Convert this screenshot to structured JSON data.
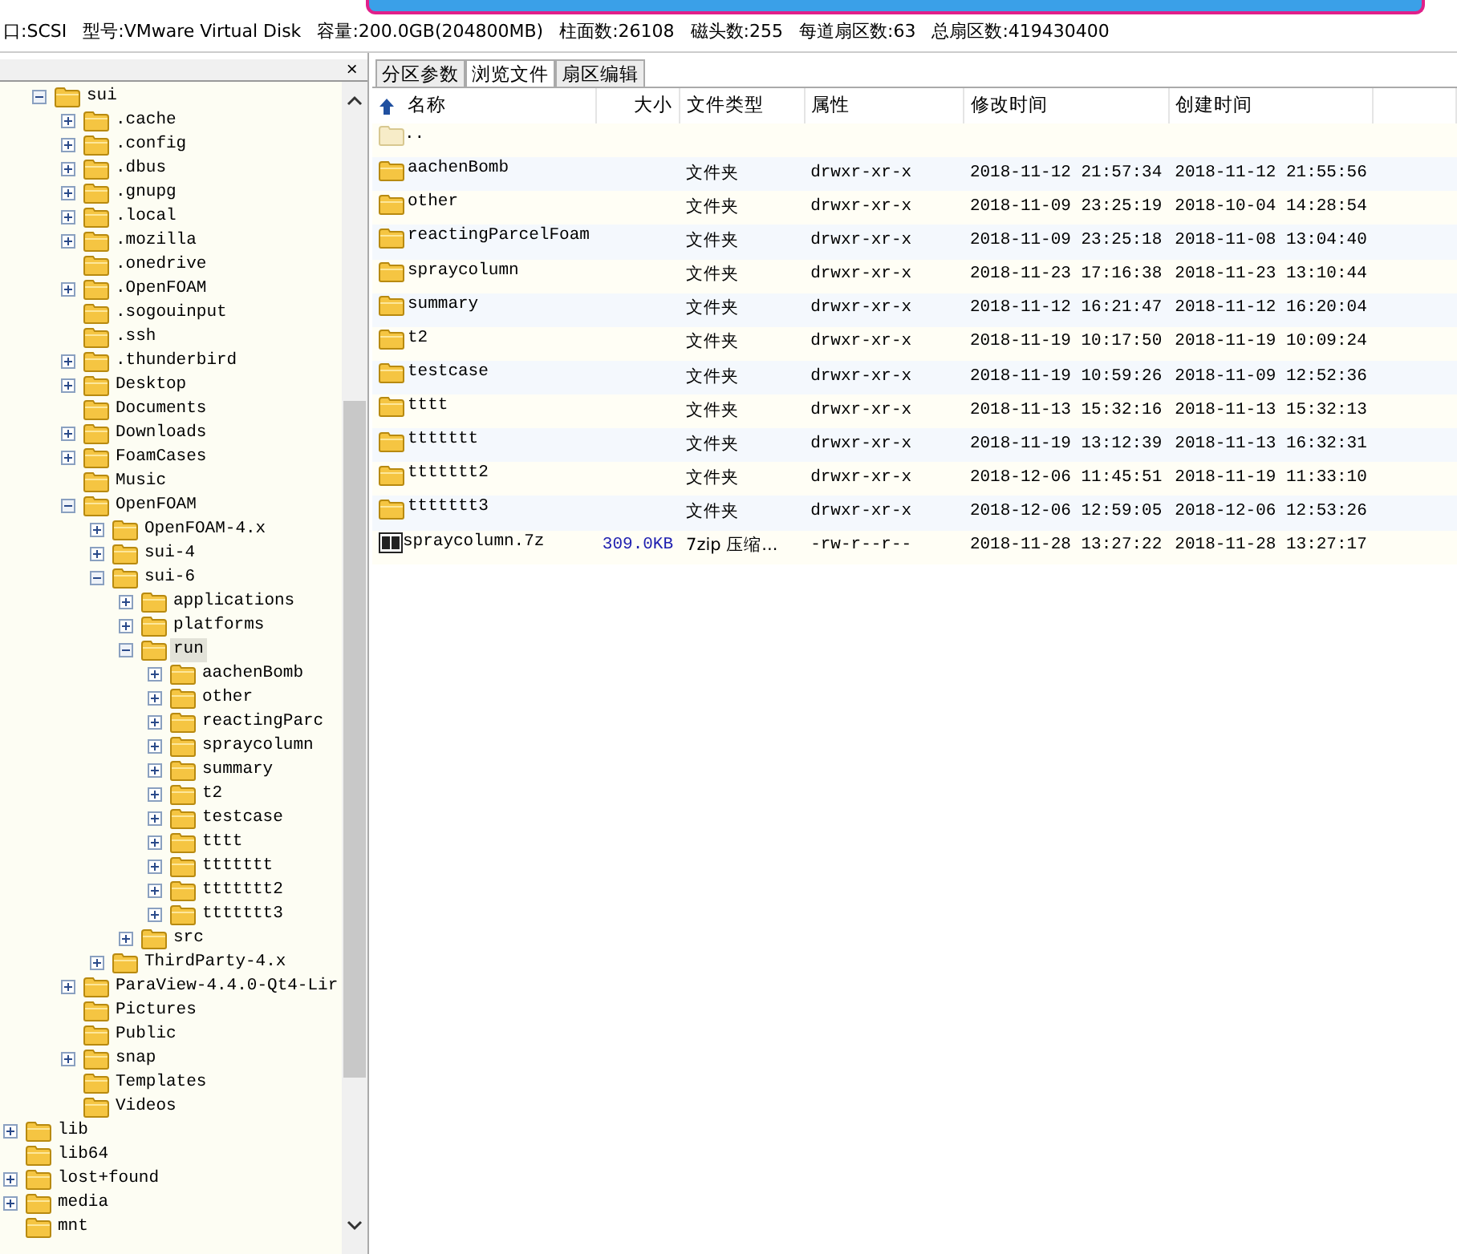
{
  "info_bar": [
    "口:SCSI",
    "型号:VMware Virtual Disk",
    "容量:200.0GB(204800MB)",
    "柱面数:26108",
    "磁头数:255",
    "每道扇区数:63",
    "总扇区数:419430400"
  ],
  "tree": {
    "close": "×",
    "items": [
      {
        "children": [
          {
            "label": "sui",
            "expanded": true,
            "selected": false,
            "children": [
              {
                "label": ".cache",
                "expanded": false,
                "selected": false
              },
              {
                "label": ".config",
                "expanded": false,
                "selected": false
              },
              {
                "label": ".dbus",
                "expanded": false,
                "selected": false
              },
              {
                "label": ".gnupg",
                "expanded": false,
                "selected": false
              },
              {
                "label": ".local",
                "expanded": false,
                "selected": false
              },
              {
                "label": ".mozilla",
                "expanded": false,
                "selected": false
              },
              {
                "label": ".onedrive",
                "selected": false
              },
              {
                "label": ".OpenFOAM",
                "expanded": false,
                "selected": false
              },
              {
                "label": ".sogouinput",
                "selected": false
              },
              {
                "label": ".ssh",
                "selected": false
              },
              {
                "label": ".thunderbird",
                "expanded": false,
                "selected": false
              },
              {
                "label": "Desktop",
                "expanded": false,
                "selected": false
              },
              {
                "label": "Documents",
                "selected": false
              },
              {
                "label": "Downloads",
                "expanded": false,
                "selected": false
              },
              {
                "label": "FoamCases",
                "expanded": false,
                "selected": false
              },
              {
                "label": "Music",
                "selected": false
              },
              {
                "label": "OpenFOAM",
                "expanded": true,
                "selected": false,
                "children": [
                  {
                    "label": "OpenFOAM-4.x",
                    "expanded": false,
                    "selected": false
                  },
                  {
                    "label": "sui-4",
                    "expanded": false,
                    "selected": false
                  },
                  {
                    "label": "sui-6",
                    "expanded": true,
                    "selected": false,
                    "children": [
                      {
                        "label": "applications",
                        "expanded": false,
                        "selected": false
                      },
                      {
                        "label": "platforms",
                        "expanded": false,
                        "selected": false
                      },
                      {
                        "label": "run",
                        "expanded": true,
                        "selected": true,
                        "children": [
                          {
                            "label": "aachenBomb",
                            "expanded": false,
                            "selected": false
                          },
                          {
                            "label": "other",
                            "expanded": false,
                            "selected": false
                          },
                          {
                            "label": "reactingParc",
                            "expanded": false,
                            "selected": false
                          },
                          {
                            "label": "spraycolumn",
                            "expanded": false,
                            "selected": false
                          },
                          {
                            "label": "summary",
                            "expanded": false,
                            "selected": false
                          },
                          {
                            "label": "t2",
                            "expanded": false,
                            "selected": false
                          },
                          {
                            "label": "testcase",
                            "expanded": false,
                            "selected": false
                          },
                          {
                            "label": "tttt",
                            "expanded": false,
                            "selected": false
                          },
                          {
                            "label": "ttttttt",
                            "expanded": false,
                            "selected": false
                          },
                          {
                            "label": "ttttttt2",
                            "expanded": false,
                            "selected": false
                          },
                          {
                            "label": "ttttttt3",
                            "expanded": false,
                            "selected": false
                          }
                        ]
                      },
                      {
                        "label": "src",
                        "expanded": false,
                        "selected": false
                      }
                    ]
                  },
                  {
                    "label": "ThirdParty-4.x",
                    "expanded": false,
                    "selected": false
                  }
                ]
              },
              {
                "label": "ParaView-4.4.0-Qt4-Lir",
                "expanded": false,
                "selected": false
              },
              {
                "label": "Pictures",
                "selected": false
              },
              {
                "label": "Public",
                "selected": false
              },
              {
                "label": "snap",
                "expanded": false,
                "selected": false
              },
              {
                "label": "Templates",
                "selected": false
              },
              {
                "label": "Videos",
                "selected": false
              }
            ]
          }
        ]
      },
      {
        "label": "lib",
        "expanded": false,
        "selected": false
      },
      {
        "label": "lib64",
        "selected": false
      },
      {
        "label": "lost+found",
        "expanded": false,
        "selected": false
      },
      {
        "label": "media",
        "expanded": false,
        "selected": false
      },
      {
        "label": "mnt",
        "selected": false
      }
    ]
  },
  "tabs": [
    {
      "label": "分区参数",
      "selected": false
    },
    {
      "label": "浏览文件",
      "selected": true
    },
    {
      "label": "扇区编辑",
      "selected": false
    }
  ],
  "columns": [
    "名称",
    "大小",
    "文件类型",
    "属性",
    "修改时间",
    "创建时间"
  ],
  "rows": [
    {
      "kind": "parent",
      "name": ".."
    },
    {
      "kind": "folder",
      "name": "aachenBomb",
      "type": "文件夹",
      "attr": "drwxr-xr-x",
      "modified": "2018-11-12 21:57:34",
      "created": "2018-11-12 21:55:56"
    },
    {
      "kind": "folder",
      "name": "other",
      "type": "文件夹",
      "attr": "drwxr-xr-x",
      "modified": "2018-11-09 23:25:19",
      "created": "2018-10-04 14:28:54"
    },
    {
      "kind": "folder",
      "name": "reactingParcelFoam",
      "type": "文件夹",
      "attr": "drwxr-xr-x",
      "modified": "2018-11-09 23:25:18",
      "created": "2018-11-08 13:04:40"
    },
    {
      "kind": "folder",
      "name": "spraycolumn",
      "type": "文件夹",
      "attr": "drwxr-xr-x",
      "modified": "2018-11-23 17:16:38",
      "created": "2018-11-23 13:10:44"
    },
    {
      "kind": "folder",
      "name": "summary",
      "type": "文件夹",
      "attr": "drwxr-xr-x",
      "modified": "2018-11-12 16:21:47",
      "created": "2018-11-12 16:20:04"
    },
    {
      "kind": "folder",
      "name": "t2",
      "type": "文件夹",
      "attr": "drwxr-xr-x",
      "modified": "2018-11-19 10:17:50",
      "created": "2018-11-19 10:09:24"
    },
    {
      "kind": "folder",
      "name": "testcase",
      "type": "文件夹",
      "attr": "drwxr-xr-x",
      "modified": "2018-11-19 10:59:26",
      "created": "2018-11-09 12:52:36"
    },
    {
      "kind": "folder",
      "name": "tttt",
      "type": "文件夹",
      "attr": "drwxr-xr-x",
      "modified": "2018-11-13 15:32:16",
      "created": "2018-11-13 15:32:13"
    },
    {
      "kind": "folder",
      "name": "ttttttt",
      "type": "文件夹",
      "attr": "drwxr-xr-x",
      "modified": "2018-11-19 13:12:39",
      "created": "2018-11-13 16:32:31"
    },
    {
      "kind": "folder",
      "name": "ttttttt2",
      "type": "文件夹",
      "attr": "drwxr-xr-x",
      "modified": "2018-12-06 11:45:51",
      "created": "2018-11-19 11:33:10"
    },
    {
      "kind": "folder",
      "name": "ttttttt3",
      "type": "文件夹",
      "attr": "drwxr-xr-x",
      "modified": "2018-12-06 12:59:05",
      "created": "2018-12-06 12:53:26"
    },
    {
      "kind": "archive",
      "name": "spraycolumn.7z",
      "size": "309.0KB",
      "type": "7zip 压缩...",
      "attr": "-rw-r--r--",
      "modified": "2018-11-28 13:27:22",
      "created": "2018-11-28 13:27:17"
    }
  ]
}
